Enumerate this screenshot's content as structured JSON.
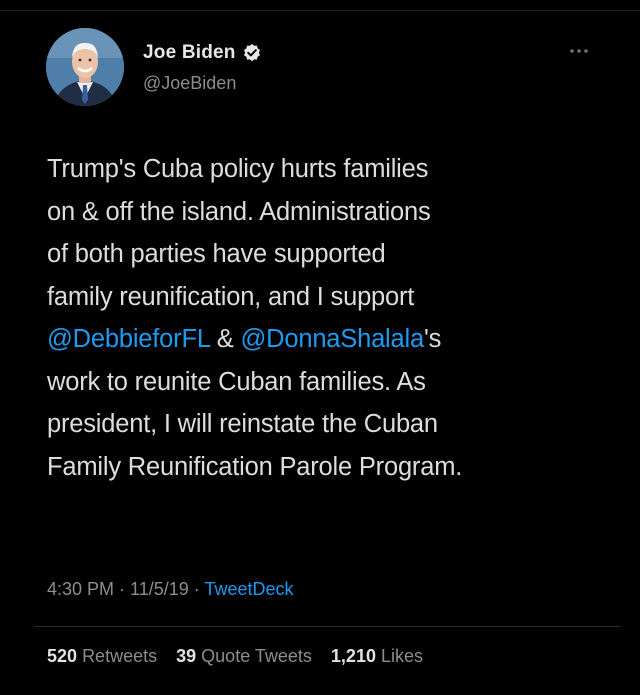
{
  "author": {
    "display_name": "Joe Biden",
    "handle": "@JoeBiden",
    "avatar_icon": "user-avatar-photo",
    "verified_icon": "verified-badge-icon",
    "more_icon": "more-options-icon"
  },
  "tweet": {
    "lines": [
      {
        "text": "Trump's Cuba policy hurts families"
      },
      {
        "text": "on & off the island. Administrations"
      },
      {
        "text": "of both parties have supported"
      },
      {
        "text": "family reunification, and I support"
      },
      {
        "mention1": "@DebbieforFL",
        "middle": " & ",
        "mention2": "@DonnaShalala",
        "after": "'s"
      },
      {
        "text": "work to reunite Cuban families. As"
      },
      {
        "text": "president, I will reinstate the Cuban"
      },
      {
        "text": "Family Reunification Parole Program."
      }
    ]
  },
  "meta": {
    "time": "4:30 PM",
    "sep1": " · ",
    "date": "11/5/19",
    "sep2": " · ",
    "source": "TweetDeck"
  },
  "stats": {
    "retweets_count": "520",
    "retweets_label": "Retweets",
    "quotes_count": "39",
    "quotes_label": "Quote Tweets",
    "likes_count": "1,210",
    "likes_label": "Likes"
  },
  "colors": {
    "background": "#000000",
    "text": "#dddddd",
    "muted": "#8a8d91",
    "link": "#1c9bf0"
  }
}
